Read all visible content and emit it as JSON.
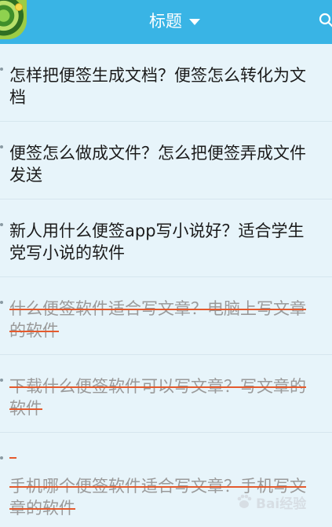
{
  "header": {
    "title": "标题",
    "accent_color": "#39b4e5",
    "icons": [
      "avatar",
      "dropdown-caret-icon",
      "search-icon"
    ]
  },
  "notes": [
    {
      "text": "怎样把便签生成文档？便签怎么转化为文档",
      "done": false
    },
    {
      "text": "便签怎么做成文件？怎么把便签弄成文件发送",
      "done": false
    },
    {
      "text": "新人用什么便签app写小说好？适合学生党写小说的软件",
      "done": false
    },
    {
      "text": "什么便签软件适合写文章？电脑上写文章的软件",
      "done": true
    },
    {
      "text": "下载什么便签软件可以写文章？写文章的软件",
      "done": true
    },
    {
      "text": "手机哪个便签软件适合写文章？手机写文章的软件",
      "done": true
    }
  ],
  "watermark": "Bai经验"
}
